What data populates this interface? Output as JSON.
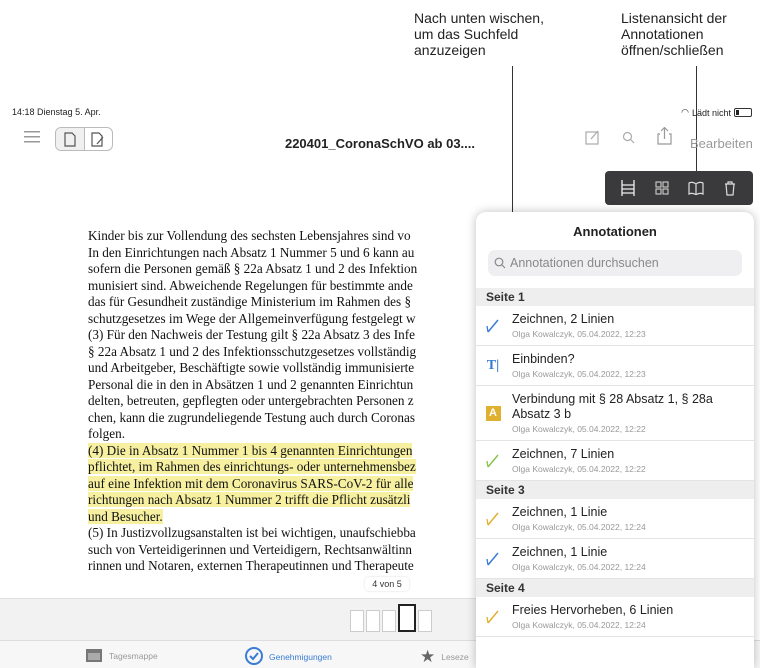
{
  "callouts": {
    "search": "Nach unten wischen,\num das Suchfeld\nanzuzeigen",
    "list": "Listenansicht der\nAnnotationen\nöffnen/schließen"
  },
  "status": {
    "time": "14:18",
    "date": "Dienstag 5. Apr.",
    "charging": "Lädt nicht"
  },
  "toolbar": {
    "doc_title": "220401_CoronaSchVO ab 03....",
    "edit_label": "Bearbeiten"
  },
  "document": {
    "lines": [
      {
        "text": "Kinder bis zur Vollendung des sechsten Lebensjahres sind vo",
        "hl": false
      },
      {
        "text": "In den Einrichtungen nach Absatz 1 Nummer 5 und 6 kann au",
        "hl": false
      },
      {
        "text": "sofern die Personen gemäß § 22a Absatz 1 und 2 des Infektion",
        "hl": false
      },
      {
        "text": "munisiert sind. Abweichende Regelungen für bestimmte ande",
        "hl": false
      },
      {
        "text": "das für Gesundheit zuständige Ministerium im Rahmen des §",
        "hl": false
      },
      {
        "text": "schutzgesetzes im Wege der Allgemeinverfügung festgelegt w",
        "hl": false
      },
      {
        "text": "(3) Für den Nachweis der Testung gilt § 22a Absatz 3 des Infe",
        "hl": false
      },
      {
        "text": "§ 22a Absatz 1 und 2 des Infektionsschutzgesetzes vollständig",
        "hl": false
      },
      {
        "text": "und Arbeitgeber, Beschäftigte sowie vollständig immunisierte",
        "hl": false
      },
      {
        "text": "Personal die in den in Absätzen 1 und 2 genannten Einrichtun",
        "hl": false
      },
      {
        "text": "delten, betreuten, gepflegten oder untergebrachten Personen z",
        "hl": false
      },
      {
        "text": "chen, kann die zugrundeliegende Testung auch durch Coronas",
        "hl": false
      },
      {
        "text": "folgen.",
        "hl": false
      },
      {
        "text": "(4) Die in Absatz 1 Nummer 1 bis 4 genannten Einrichtungen",
        "hl": true
      },
      {
        "text": "pflichtet, im Rahmen des einrichtungs- oder unternehmensbez",
        "hl": true
      },
      {
        "text": "auf eine Infektion mit dem Coronavirus SARS-CoV-2 für alle",
        "hl": true
      },
      {
        "text": "richtungen nach Absatz 1 Nummer 2 trifft die Pflicht zusätzli",
        "hl": true
      },
      {
        "text": "und Besucher.",
        "hl": true
      },
      {
        "text": "(5) In Justizvollzugsanstalten ist bei wichtigen, unaufschiebba",
        "hl": false
      },
      {
        "text": "such von Verteidigerinnen und Verteidigern, Rechtsanwältinn",
        "hl": false
      },
      {
        "text": "rinnen und Notaren, externen Therapeutinnen und Therapeute",
        "hl": false
      }
    ]
  },
  "pager": "4 von 5",
  "panel": {
    "title": "Annotationen",
    "search_placeholder": "Annotationen durchsuchen",
    "sections": [
      {
        "label": "Seite 1",
        "items": [
          {
            "icon": "pen-icon",
            "title": "Zeichnen, 2 Linien",
            "meta": "Olga Kowalczyk, 05.04.2022, 12:23",
            "color": "#3a7bd5"
          },
          {
            "icon": "text-icon",
            "title": "Einbinden?",
            "meta": "Olga Kowalczyk, 05.04.2022, 12:23",
            "color": "#3a7bd5"
          },
          {
            "icon": "highlight-icon",
            "title": "Verbindung mit § 28 Absatz 1, § 28a Absatz 3 b",
            "meta": "Olga Kowalczyk, 05.04.2022, 12:22",
            "color": "#e0b030"
          },
          {
            "icon": "pen-icon",
            "title": "Zeichnen, 7 Linien",
            "meta": "Olga Kowalczyk, 05.04.2022, 12:22",
            "color": "#8bc34a"
          }
        ]
      },
      {
        "label": "Seite 3",
        "items": [
          {
            "icon": "pen-icon",
            "title": "Zeichnen, 1 Linie",
            "meta": "Olga Kowalczyk, 05.04.2022, 12:24",
            "color": "#e0b030"
          },
          {
            "icon": "pen-icon",
            "title": "Zeichnen, 1 Linie",
            "meta": "Olga Kowalczyk, 05.04.2022, 12:24",
            "color": "#3a7bd5"
          }
        ]
      },
      {
        "label": "Seite 4",
        "items": [
          {
            "icon": "pen-icon",
            "title": "Freies Hervorheben, 6 Linien",
            "meta": "Olga Kowalczyk, 05.04.2022, 12:24",
            "color": "#e0b030"
          }
        ]
      }
    ]
  },
  "tabs": [
    {
      "label": "Tagesmappe",
      "icon": "calendar-icon"
    },
    {
      "label": "Genehmigungen",
      "icon": "check-badge-icon"
    },
    {
      "label": "Leseze",
      "icon": "star-icon"
    }
  ]
}
